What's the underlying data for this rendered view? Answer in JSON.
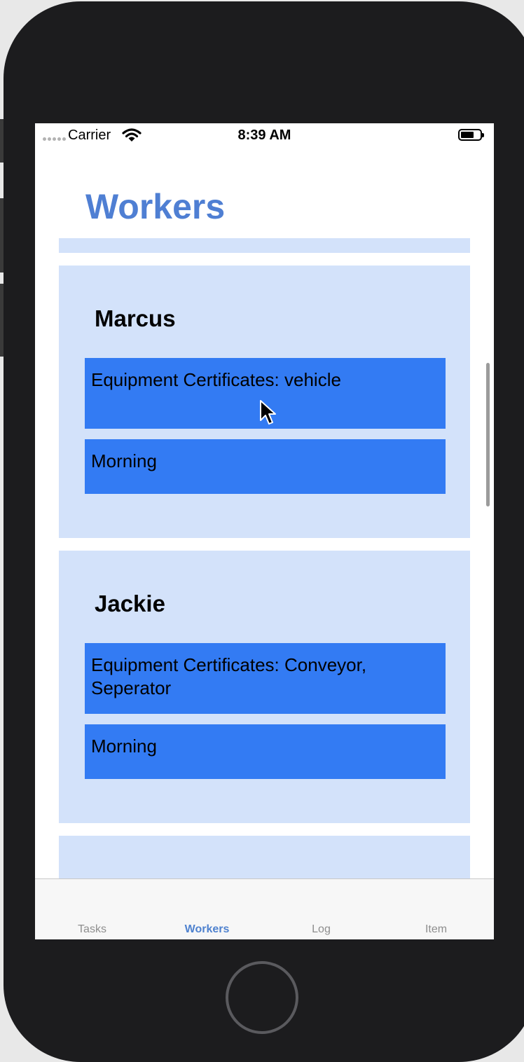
{
  "status_bar": {
    "carrier": "Carrier",
    "time": "8:39 AM",
    "signal_icon": "signal-dots-icon",
    "wifi_icon": "wifi-icon",
    "battery_icon": "battery-icon"
  },
  "page": {
    "title": "Workers"
  },
  "workers": [
    {
      "name": "Marcus",
      "certificates": "Equipment Certificates: vehicle",
      "shift": "Morning"
    },
    {
      "name": "Jackie",
      "certificates": "Equipment Certificates: Conveyor, Seperator",
      "shift": "Morning"
    }
  ],
  "tab_bar": {
    "tabs": [
      {
        "label": "Tasks"
      },
      {
        "label": "Workers"
      },
      {
        "label": "Log"
      },
      {
        "label": "Item"
      }
    ],
    "selected": "Workers"
  },
  "colors": {
    "title": "#4f7fd3",
    "card_background": "#d3e2fa",
    "pill_background": "#337bf3",
    "tab_active": "#4f82cf",
    "tab_inactive": "#8e8e8e"
  }
}
